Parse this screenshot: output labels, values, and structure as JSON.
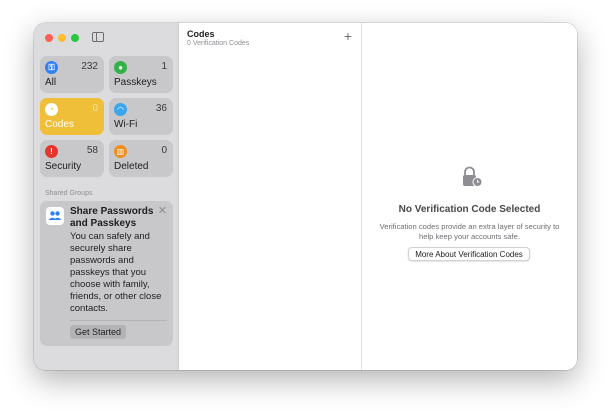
{
  "sidebar": {
    "tiles": [
      {
        "label": "All",
        "count": "232",
        "icon": "key-icon"
      },
      {
        "label": "Passkeys",
        "count": "1",
        "icon": "person-key-icon"
      },
      {
        "label": "Codes",
        "count": "0",
        "icon": "lock-clock-icon"
      },
      {
        "label": "Wi-Fi",
        "count": "36",
        "icon": "wifi-icon"
      },
      {
        "label": "Security",
        "count": "58",
        "icon": "exclamation-icon"
      },
      {
        "label": "Deleted",
        "count": "0",
        "icon": "trash-icon"
      }
    ],
    "shared_groups_label": "Shared Groups",
    "share_card": {
      "title": "Share Passwords and Passkeys",
      "body": "You can safely and securely share passwords and passkeys that you choose with family, friends, or other close contacts.",
      "button": "Get Started"
    }
  },
  "list": {
    "title": "Codes",
    "subtitle": "0 Verification Codes",
    "add_label": "+"
  },
  "detail": {
    "title": "No Verification Code Selected",
    "description": "Verification codes provide an extra layer of security to help keep your accounts safe.",
    "button": "More About Verification Codes"
  },
  "colors": {
    "accent_yellow": "#efbf3a",
    "close": "#fe5f57",
    "minimize": "#febc2e",
    "zoom": "#28c840"
  }
}
